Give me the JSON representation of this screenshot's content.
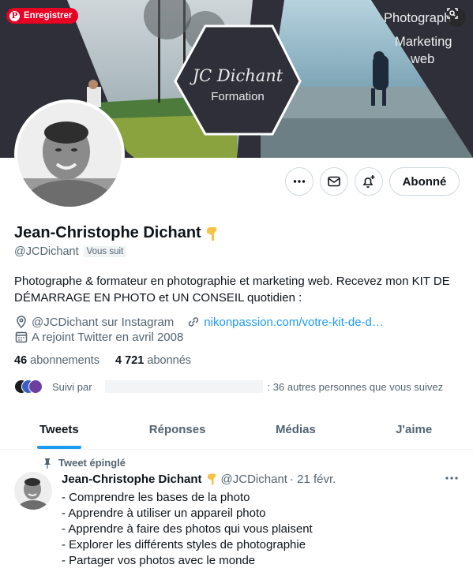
{
  "banner": {
    "save_button": "Enregistrer",
    "right_text_1": "Photograph",
    "right_text_2": "Marketing",
    "right_text_3": "web",
    "hex_title": "JC Dichant",
    "hex_subtitle": "Formation"
  },
  "actions": {
    "follow_label": "Abonné"
  },
  "profile": {
    "name": "Jean-Christophe Dichant",
    "handle": "@JCDichant",
    "follows_you": "Vous suit",
    "bio": "Photographe & formateur en photographie et marketing web. Recevez mon KIT DE DÉMARRAGE EN PHOTO et UN CONSEIL quotidien :",
    "location": "@JCDichant sur Instagram",
    "website": "nikonpassion.com/votre-kit-de-d…",
    "joined": "A rejoint Twitter en avril 2008",
    "following_count": "46",
    "following_label": "abonnements",
    "followers_count": "4 721",
    "followers_label": "abonnés",
    "followed_by_prefix": "Suivi par",
    "followed_by_suffix": ": 36 autres personnes que vous suivez"
  },
  "tabs": [
    "Tweets",
    "Réponses",
    "Médias",
    "J'aime"
  ],
  "pinned_tweet": {
    "label": "Tweet épinglé",
    "name": "Jean-Christophe Dichant",
    "handle": "@JCDichant",
    "date": "· 21 févr.",
    "lines": [
      "- Comprendre les bases de la photo",
      "- Apprendre à utiliser un appareil photo",
      "- Apprendre à faire des photos qui vous plaisent",
      "- Explorer les différents styles de photographie",
      "- Partager vos photos avec le monde"
    ]
  },
  "colors": {
    "accent": "#1d9bf0",
    "pinterest": "#e60023",
    "banner_dark": "#2e2f38"
  }
}
